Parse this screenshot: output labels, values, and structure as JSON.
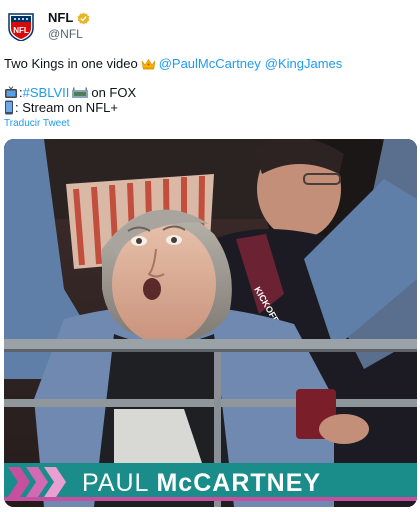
{
  "account": {
    "name": "NFL",
    "handle": "@NFL",
    "avatar_icon": "nfl-shield-icon",
    "verified_icon": "gold-verified-badge-icon",
    "verified_color": "#e8b528"
  },
  "tweet": {
    "line1_text": "Two Kings in one video",
    "line1_emoji": "crown-icon",
    "mention1": "@PaulMcCartney",
    "mention2": "@KingJames",
    "line2_emoji": "tv-icon",
    "line2_prefix": ":",
    "hashtag": "#SBLVII",
    "line2_suffix": "on FOX",
    "line3_emoji": "mobile-phone-icon",
    "line3_text": ": Stream on NFL+",
    "translate_label": "Traducir Tweet",
    "link_color": "#1d9bf0"
  },
  "media": {
    "lower_third_first": "PAUL",
    "lower_third_last": "McCARTNEY",
    "lower_third_color": "#1a8d8a",
    "chevron_color": "#c64fa0"
  }
}
